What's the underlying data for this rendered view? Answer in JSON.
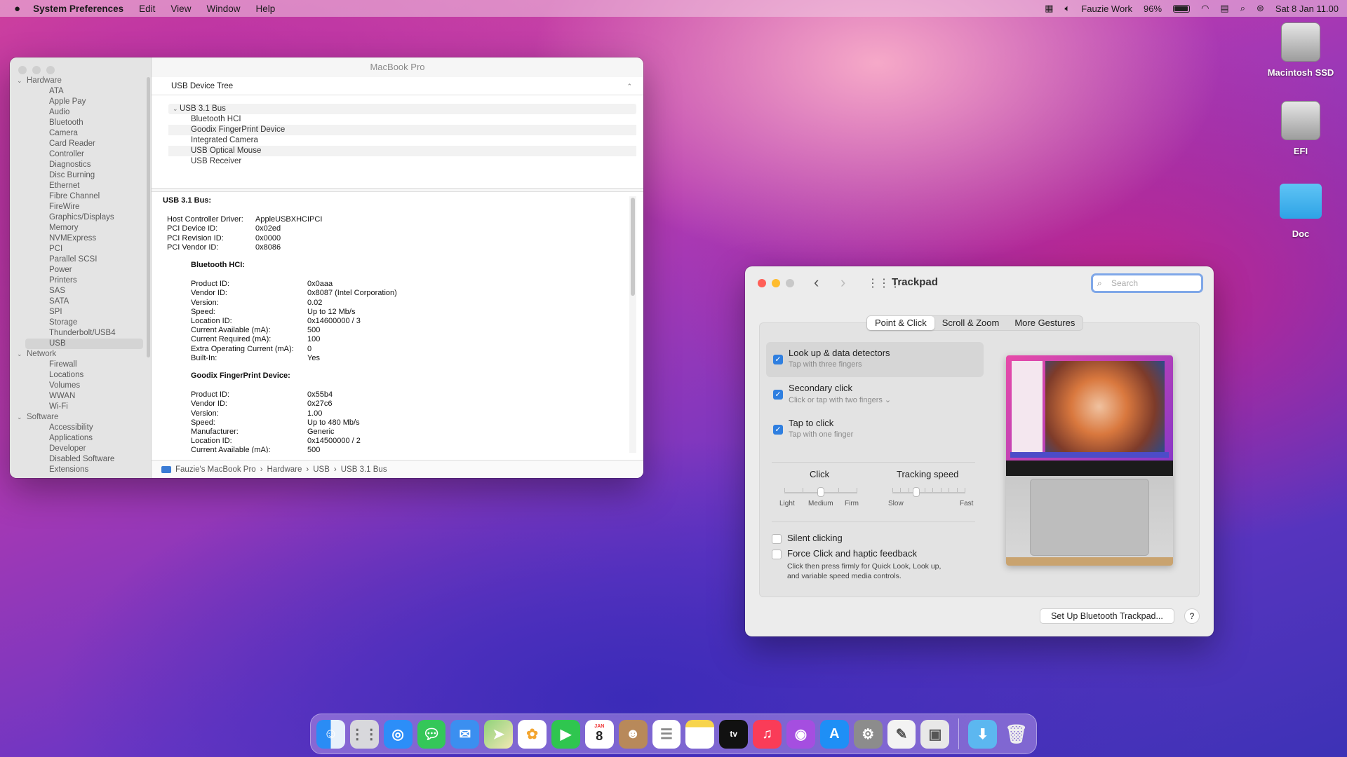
{
  "menubar": {
    "app": "System Preferences",
    "items": [
      "Edit",
      "View",
      "Window",
      "Help"
    ],
    "user": "Fauzie Work",
    "battery": "96%",
    "datetime": "Sat 8 Jan  11.00"
  },
  "desktop": {
    "icons": [
      "Macintosh SSD",
      "EFI",
      "Doc"
    ]
  },
  "sysinfo": {
    "title": "MacBook Pro",
    "sidebar": {
      "hardware_label": "Hardware",
      "hardware_items": [
        "ATA",
        "Apple Pay",
        "Audio",
        "Bluetooth",
        "Camera",
        "Card Reader",
        "Controller",
        "Diagnostics",
        "Disc Burning",
        "Ethernet",
        "Fibre Channel",
        "FireWire",
        "Graphics/Displays",
        "Memory",
        "NVMExpress",
        "PCI",
        "Parallel SCSI",
        "Power",
        "Printers",
        "SAS",
        "SATA",
        "SPI",
        "Storage",
        "Thunderbolt/USB4"
      ],
      "selected": "USB",
      "network_label": "Network",
      "network_items": [
        "Firewall",
        "Locations",
        "Volumes",
        "WWAN",
        "Wi-Fi"
      ],
      "software_label": "Software",
      "software_items": [
        "Accessibility",
        "Applications",
        "Developer",
        "Disabled Software",
        "Extensions"
      ]
    },
    "tree_header": "USB Device Tree",
    "bus": "USB 3.1 Bus",
    "devices": [
      "Bluetooth HCI",
      "Goodix FingerPrint Device",
      "Integrated Camera",
      "USB Optical Mouse",
      "USB Receiver"
    ],
    "details": {
      "heading": "USB 3.1 Bus:",
      "bus_rows": [
        {
          "k": "Host Controller Driver:",
          "v": "AppleUSBXHCIPCI"
        },
        {
          "k": "PCI Device ID:",
          "v": "0x02ed"
        },
        {
          "k": "PCI Revision ID:",
          "v": "0x0000"
        },
        {
          "k": "PCI Vendor ID:",
          "v": "0x8086"
        }
      ],
      "bt_heading": "Bluetooth HCI:",
      "bt_rows": [
        {
          "k": "Product ID:",
          "v": "0x0aaa"
        },
        {
          "k": "Vendor ID:",
          "v": "0x8087  (Intel Corporation)"
        },
        {
          "k": "Version:",
          "v": "0.02"
        },
        {
          "k": "Speed:",
          "v": "Up to 12 Mb/s"
        },
        {
          "k": "Location ID:",
          "v": "0x14600000 / 3"
        },
        {
          "k": "Current Available (mA):",
          "v": "500"
        },
        {
          "k": "Current Required (mA):",
          "v": "100"
        },
        {
          "k": "Extra Operating Current (mA):",
          "v": "0"
        },
        {
          "k": "Built-In:",
          "v": "Yes"
        }
      ],
      "gx_heading": "Goodix FingerPrint Device:",
      "gx_rows": [
        {
          "k": "Product ID:",
          "v": "0x55b4"
        },
        {
          "k": "Vendor ID:",
          "v": "0x27c6"
        },
        {
          "k": "Version:",
          "v": "1.00"
        },
        {
          "k": "Speed:",
          "v": "Up to 480 Mb/s"
        },
        {
          "k": "Manufacturer:",
          "v": "Generic"
        },
        {
          "k": "Location ID:",
          "v": "0x14500000 / 2"
        },
        {
          "k": "Current Available (mA):",
          "v": "500"
        }
      ]
    },
    "path": [
      "Fauzie's MacBook Pro",
      "Hardware",
      "USB",
      "USB 3.1 Bus"
    ]
  },
  "trackpad": {
    "title": "Trackpad",
    "search_placeholder": "Search",
    "tabs": [
      "Point & Click",
      "Scroll & Zoom",
      "More Gestures"
    ],
    "options": [
      {
        "title": "Look up & data detectors",
        "sub": "Tap with three fingers",
        "checked": true
      },
      {
        "title": "Secondary click",
        "sub": "Click or tap with two fingers ⌄",
        "checked": true
      },
      {
        "title": "Tap to click",
        "sub": "Tap with one finger",
        "checked": true
      }
    ],
    "click": {
      "label": "Click",
      "min": "Light",
      "mid": "Medium",
      "max": "Firm",
      "level": 0.5
    },
    "tracking": {
      "label": "Tracking speed",
      "min": "Slow",
      "max": "Fast",
      "level": 0.33
    },
    "silent": "Silent clicking",
    "force": "Force Click and haptic feedback",
    "force_desc1": "Click then press firmly for Quick Look, Look up,",
    "force_desc2": "and variable speed media controls.",
    "setup_button": "Set Up Bluetooth Trackpad...",
    "help": "?"
  },
  "colors": {
    "accent": "#2f7fe0",
    "close": "#ff5f57",
    "min": "#febc2e",
    "max": "#c8c8c8"
  }
}
